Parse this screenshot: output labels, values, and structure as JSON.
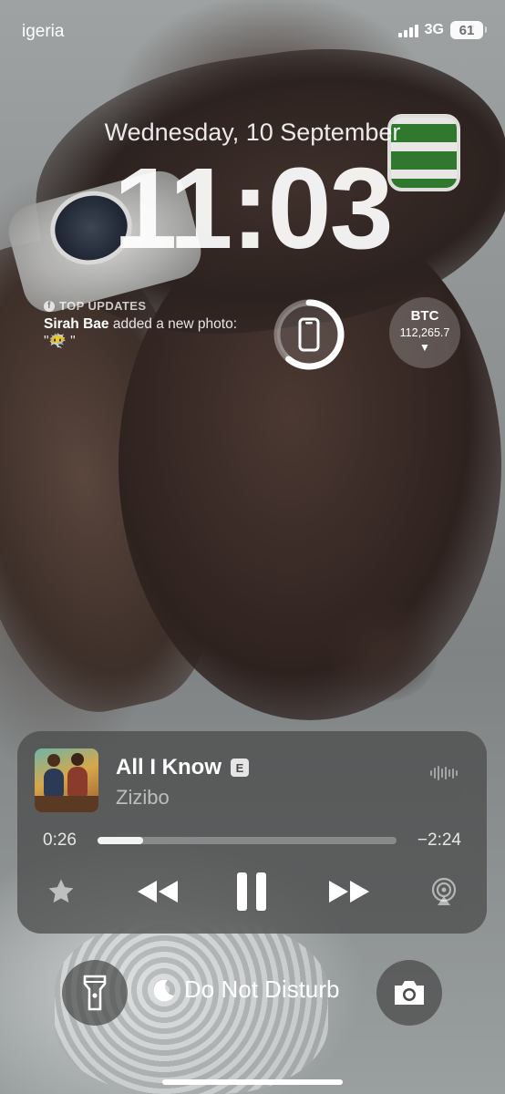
{
  "status_bar": {
    "carrier": "igeria",
    "network": "3G",
    "battery": "61"
  },
  "lock_screen": {
    "date": "Wednesday, 10 September",
    "time": "11:03"
  },
  "widgets": {
    "top_updates": {
      "header": "TOP UPDATES",
      "name": "Sirah Bae",
      "message": "added a new photo: \"😶‍🌫️ \""
    },
    "phone_battery": {
      "icon": "phone-icon",
      "level": 0.61
    },
    "btc": {
      "label": "BTC",
      "value": "112,265.7",
      "trend": "▼"
    }
  },
  "now_playing": {
    "title": "All I Know",
    "explicit": "E",
    "artist": "Zizibo",
    "elapsed": "0:26",
    "remaining": "−2:24",
    "progress": 0.153,
    "controls": [
      "star-icon",
      "rewind-icon",
      "pause-icon",
      "fast-forward-icon",
      "airplay-icon"
    ]
  },
  "bottom": {
    "focus_label": "Do Not Disturb",
    "left_button_icon": "flashlight-icon",
    "right_button_icon": "camera-icon"
  }
}
